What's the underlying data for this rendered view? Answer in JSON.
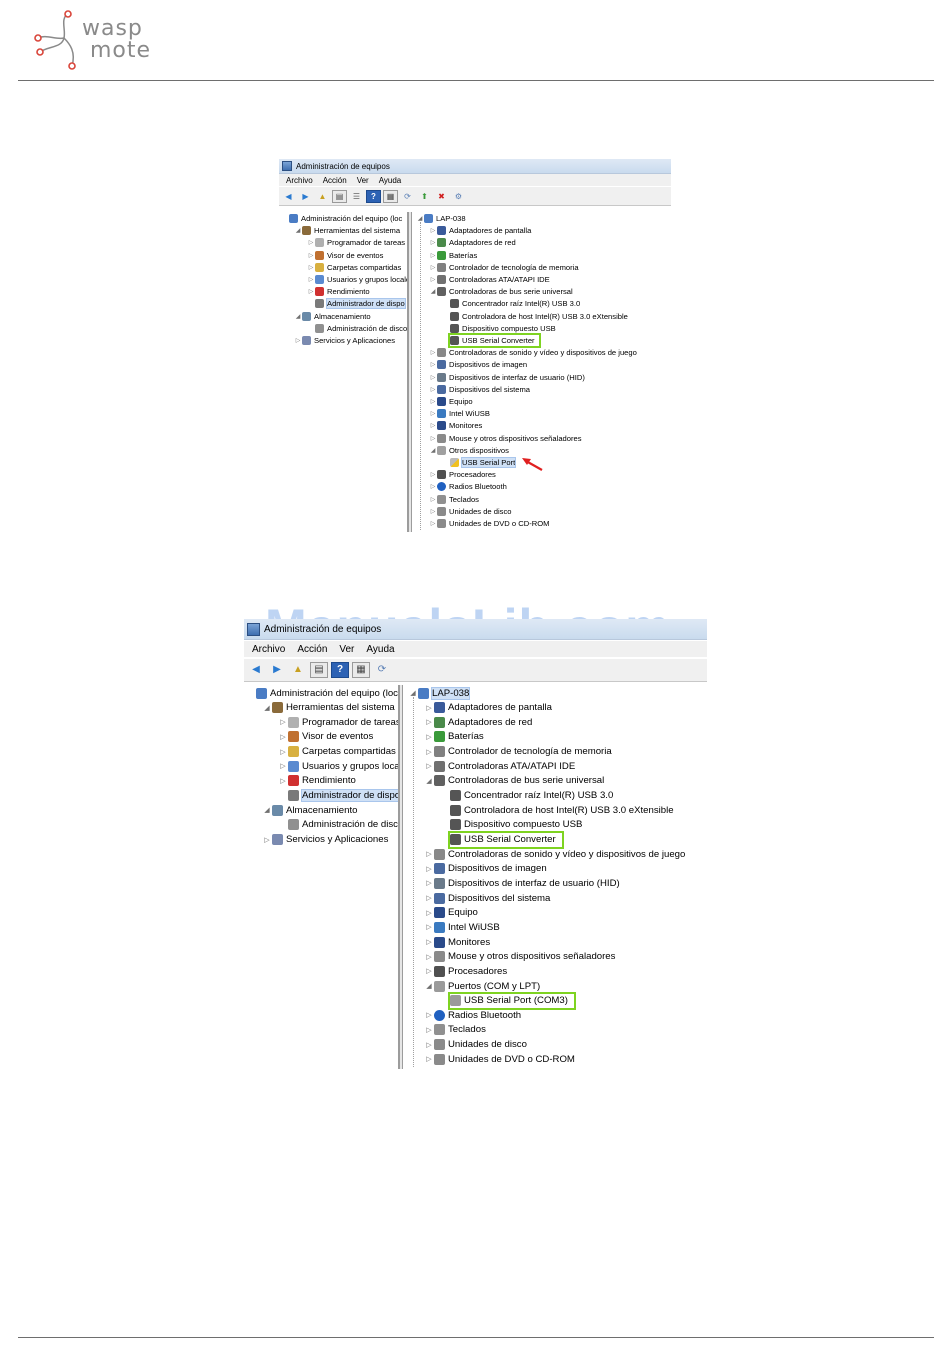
{
  "logo": {
    "line1": "wasp",
    "line2": "mote"
  },
  "window1": {
    "title": "Administración de equipos",
    "menu": [
      "Archivo",
      "Acción",
      "Ver",
      "Ayuda"
    ],
    "left_tree": [
      {
        "label": "Administración del equipo (loc",
        "indent": 0,
        "expander": "",
        "icon": "computer-icon"
      },
      {
        "label": "Herramientas del sistema",
        "indent": 1,
        "expander": "◢",
        "icon": "tools-icon"
      },
      {
        "label": "Programador de tareas",
        "indent": 2,
        "expander": "▷",
        "icon": "clock-icon"
      },
      {
        "label": "Visor de eventos",
        "indent": 2,
        "expander": "▷",
        "icon": "event-viewer-icon"
      },
      {
        "label": "Carpetas compartidas",
        "indent": 2,
        "expander": "▷",
        "icon": "shared-folder-icon"
      },
      {
        "label": "Usuarios y grupos locale",
        "indent": 2,
        "expander": "▷",
        "icon": "users-icon"
      },
      {
        "label": "Rendimiento",
        "indent": 2,
        "expander": "▷",
        "icon": "performance-icon"
      },
      {
        "label": "Administrador de dispo",
        "indent": 2,
        "expander": "",
        "icon": "device-manager-icon",
        "selected": true
      },
      {
        "label": "Almacenamiento",
        "indent": 1,
        "expander": "◢",
        "icon": "storage-icon"
      },
      {
        "label": "Administración de disco",
        "indent": 2,
        "expander": "",
        "icon": "disk-icon"
      },
      {
        "label": "Servicios y Aplicaciones",
        "indent": 1,
        "expander": "▷",
        "icon": "services-icon"
      }
    ],
    "right_tree": [
      {
        "label": "LAP-038",
        "indent": 0,
        "expander": "◢",
        "icon": "computer-icon"
      },
      {
        "label": "Adaptadores de pantalla",
        "indent": 1,
        "expander": "▷",
        "icon": "display-adapter-icon"
      },
      {
        "label": "Adaptadores de red",
        "indent": 1,
        "expander": "▷",
        "icon": "network-icon"
      },
      {
        "label": "Baterías",
        "indent": 1,
        "expander": "▷",
        "icon": "battery-icon"
      },
      {
        "label": "Controlador de tecnología de memoria",
        "indent": 1,
        "expander": "▷",
        "icon": "memory-icon"
      },
      {
        "label": "Controladoras ATA/ATAPI IDE",
        "indent": 1,
        "expander": "▷",
        "icon": "ide-icon"
      },
      {
        "label": "Controladoras de bus serie universal",
        "indent": 1,
        "expander": "◢",
        "icon": "usb-icon"
      },
      {
        "label": "Concentrador raíz Intel(R) USB 3.0",
        "indent": 2,
        "expander": "",
        "icon": "usb-plug-icon"
      },
      {
        "label": "Controladora de host Intel(R) USB 3.0 eXtensible",
        "indent": 2,
        "expander": "",
        "icon": "usb-plug-icon"
      },
      {
        "label": "Dispositivo compuesto USB",
        "indent": 2,
        "expander": "",
        "icon": "usb-plug-icon"
      },
      {
        "label": "USB Serial Converter",
        "indent": 2,
        "expander": "",
        "icon": "usb-plug-icon",
        "highlight": true
      },
      {
        "label": "Controladoras de sonido y vídeo y dispositivos de juego",
        "indent": 1,
        "expander": "▷",
        "icon": "sound-icon"
      },
      {
        "label": "Dispositivos de imagen",
        "indent": 1,
        "expander": "▷",
        "icon": "camera-icon"
      },
      {
        "label": "Dispositivos de interfaz de usuario (HID)",
        "indent": 1,
        "expander": "▷",
        "icon": "hid-icon"
      },
      {
        "label": "Dispositivos del sistema",
        "indent": 1,
        "expander": "▷",
        "icon": "system-device-icon"
      },
      {
        "label": "Equipo",
        "indent": 1,
        "expander": "▷",
        "icon": "monitor-icon"
      },
      {
        "label": "Intel WiUSB",
        "indent": 1,
        "expander": "▷",
        "icon": "wiusb-icon"
      },
      {
        "label": "Monitores",
        "indent": 1,
        "expander": "▷",
        "icon": "monitor-icon"
      },
      {
        "label": "Mouse y otros dispositivos señaladores",
        "indent": 1,
        "expander": "▷",
        "icon": "mouse-icon"
      },
      {
        "label": "Otros dispositivos",
        "indent": 1,
        "expander": "◢",
        "icon": "unknown-device-icon"
      },
      {
        "label": "USB Serial Port",
        "indent": 2,
        "expander": "",
        "icon": "warning-device-icon",
        "selected": true
      },
      {
        "label": "Procesadores",
        "indent": 1,
        "expander": "▷",
        "icon": "processor-icon"
      },
      {
        "label": "Radios Bluetooth",
        "indent": 1,
        "expander": "▷",
        "icon": "bluetooth-icon"
      },
      {
        "label": "Teclados",
        "indent": 1,
        "expander": "▷",
        "icon": "keyboard-icon"
      },
      {
        "label": "Unidades de disco",
        "indent": 1,
        "expander": "▷",
        "icon": "disk-drive-icon"
      },
      {
        "label": "Unidades de DVD o CD-ROM",
        "indent": 1,
        "expander": "▷",
        "icon": "dvd-icon"
      }
    ]
  },
  "window2": {
    "title": "Administración de equipos",
    "menu": [
      "Archivo",
      "Acción",
      "Ver",
      "Ayuda"
    ],
    "left_tree": [
      {
        "label": "Administración del equipo (loc",
        "indent": 0,
        "expander": "",
        "icon": "computer-icon"
      },
      {
        "label": "Herramientas del sistema",
        "indent": 1,
        "expander": "◢",
        "icon": "tools-icon"
      },
      {
        "label": "Programador de tareas",
        "indent": 2,
        "expander": "▷",
        "icon": "clock-icon"
      },
      {
        "label": "Visor de eventos",
        "indent": 2,
        "expander": "▷",
        "icon": "event-viewer-icon"
      },
      {
        "label": "Carpetas compartidas",
        "indent": 2,
        "expander": "▷",
        "icon": "shared-folder-icon"
      },
      {
        "label": "Usuarios y grupos locale",
        "indent": 2,
        "expander": "▷",
        "icon": "users-icon"
      },
      {
        "label": "Rendimiento",
        "indent": 2,
        "expander": "▷",
        "icon": "performance-icon"
      },
      {
        "label": "Administrador de dispo",
        "indent": 2,
        "expander": "",
        "icon": "device-manager-icon",
        "selected": true
      },
      {
        "label": "Almacenamiento",
        "indent": 1,
        "expander": "◢",
        "icon": "storage-icon"
      },
      {
        "label": "Administración de disco",
        "indent": 2,
        "expander": "",
        "icon": "disk-icon"
      },
      {
        "label": "Servicios y Aplicaciones",
        "indent": 1,
        "expander": "▷",
        "icon": "services-icon"
      }
    ],
    "right_tree": [
      {
        "label": "LAP-038",
        "indent": 0,
        "expander": "◢",
        "icon": "computer-icon",
        "selected": true
      },
      {
        "label": "Adaptadores de pantalla",
        "indent": 1,
        "expander": "▷",
        "icon": "display-adapter-icon"
      },
      {
        "label": "Adaptadores de red",
        "indent": 1,
        "expander": "▷",
        "icon": "network-icon"
      },
      {
        "label": "Baterías",
        "indent": 1,
        "expander": "▷",
        "icon": "battery-icon"
      },
      {
        "label": "Controlador de tecnología de memoria",
        "indent": 1,
        "expander": "▷",
        "icon": "memory-icon"
      },
      {
        "label": "Controladoras ATA/ATAPI IDE",
        "indent": 1,
        "expander": "▷",
        "icon": "ide-icon"
      },
      {
        "label": "Controladoras de bus serie universal",
        "indent": 1,
        "expander": "◢",
        "icon": "usb-icon"
      },
      {
        "label": "Concentrador raíz Intel(R) USB 3.0",
        "indent": 2,
        "expander": "",
        "icon": "usb-plug-icon"
      },
      {
        "label": "Controladora de host Intel(R) USB 3.0 eXtensible",
        "indent": 2,
        "expander": "",
        "icon": "usb-plug-icon"
      },
      {
        "label": "Dispositivo compuesto USB",
        "indent": 2,
        "expander": "",
        "icon": "usb-plug-icon"
      },
      {
        "label": "USB Serial Converter",
        "indent": 2,
        "expander": "",
        "icon": "usb-plug-icon",
        "highlight": true
      },
      {
        "label": "Controladoras de sonido y vídeo y dispositivos de juego",
        "indent": 1,
        "expander": "▷",
        "icon": "sound-icon"
      },
      {
        "label": "Dispositivos de imagen",
        "indent": 1,
        "expander": "▷",
        "icon": "camera-icon"
      },
      {
        "label": "Dispositivos de interfaz de usuario (HID)",
        "indent": 1,
        "expander": "▷",
        "icon": "hid-icon"
      },
      {
        "label": "Dispositivos del sistema",
        "indent": 1,
        "expander": "▷",
        "icon": "system-device-icon"
      },
      {
        "label": "Equipo",
        "indent": 1,
        "expander": "▷",
        "icon": "monitor-icon"
      },
      {
        "label": "Intel WiUSB",
        "indent": 1,
        "expander": "▷",
        "icon": "wiusb-icon"
      },
      {
        "label": "Monitores",
        "indent": 1,
        "expander": "▷",
        "icon": "monitor-icon"
      },
      {
        "label": "Mouse y otros dispositivos señaladores",
        "indent": 1,
        "expander": "▷",
        "icon": "mouse-icon"
      },
      {
        "label": "Procesadores",
        "indent": 1,
        "expander": "▷",
        "icon": "processor-icon"
      },
      {
        "label": "Puertos (COM y LPT)",
        "indent": 1,
        "expander": "◢",
        "icon": "port-icon"
      },
      {
        "label": "USB Serial Port (COM3)",
        "indent": 2,
        "expander": "",
        "icon": "port-icon",
        "highlight": true
      },
      {
        "label": "Radios Bluetooth",
        "indent": 1,
        "expander": "▷",
        "icon": "bluetooth-icon"
      },
      {
        "label": "Teclados",
        "indent": 1,
        "expander": "▷",
        "icon": "keyboard-icon"
      },
      {
        "label": "Unidades de disco",
        "indent": 1,
        "expander": "▷",
        "icon": "disk-drive-icon"
      },
      {
        "label": "Unidades de DVD o CD-ROM",
        "indent": 1,
        "expander": "▷",
        "icon": "dvd-icon"
      }
    ]
  },
  "watermark": "ManualsLib.com",
  "colors": {
    "highlight": "#7ed321",
    "arrow": "#e02020",
    "selection": "#cfe0f5"
  }
}
